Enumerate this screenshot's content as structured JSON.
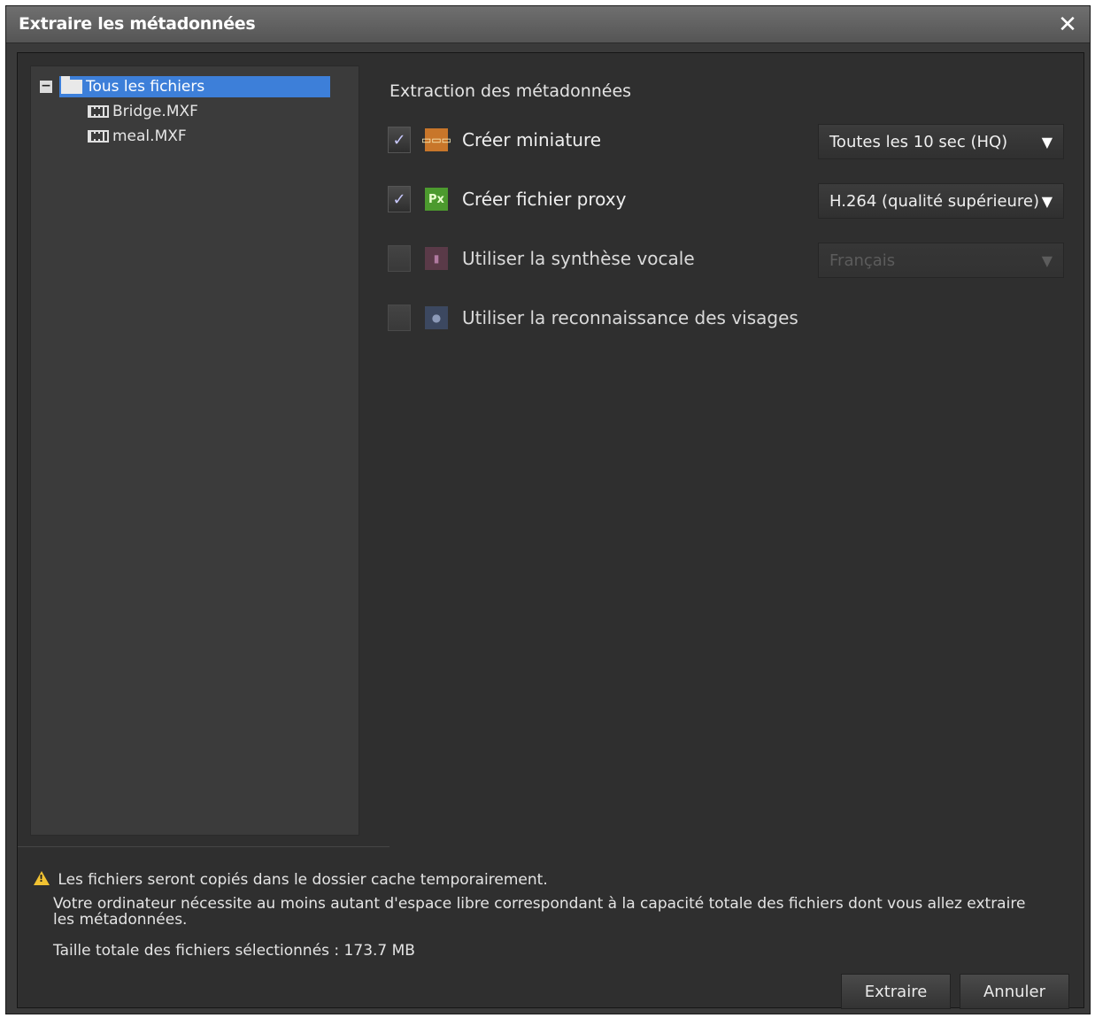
{
  "window": {
    "title": "Extraire les métadonnées",
    "close_glyph": "✕"
  },
  "tree": {
    "root": {
      "label": "Tous les fichiers",
      "toggle": "−",
      "icon": "folder-icon",
      "selected": true
    },
    "children": [
      {
        "label": "Bridge.MXF",
        "icon": "film-clip-icon"
      },
      {
        "label": "meal.MXF",
        "icon": "film-clip-icon"
      }
    ]
  },
  "options": {
    "section_title": "Extraction des métadonnées",
    "items": [
      {
        "label": "Créer miniature",
        "checked": true,
        "enabled": true,
        "icon": "thumbnail-icon",
        "icon_text": "▭▭▭",
        "dropdown": "Toutes les 10 sec (HQ)"
      },
      {
        "label": "Créer fichier proxy",
        "checked": true,
        "enabled": true,
        "icon": "proxy-icon",
        "icon_text": "Px",
        "dropdown": "H.264 (qualité supérieure)"
      },
      {
        "label": "Utiliser la synthèse vocale",
        "checked": false,
        "enabled": true,
        "icon": "speech-icon",
        "icon_text": "▮",
        "dropdown": "Français",
        "dropdown_disabled": true
      },
      {
        "label": "Utiliser la reconnaissance des visages",
        "checked": false,
        "enabled": true,
        "icon": "face-icon",
        "icon_text": "●"
      }
    ],
    "check_glyph": "✓",
    "dropdown_arrow": "▼"
  },
  "notices": {
    "warning": "Les fichiers seront copiés dans le dossier cache temporairement.",
    "space": "Votre ordinateur nécessite au moins autant d'espace libre correspondant à la capacité totale des fichiers dont vous allez extraire les métadonnées.",
    "total": "Taille totale des fichiers sélectionnés : 173.7 MB"
  },
  "buttons": {
    "extract": "Extraire",
    "cancel": "Annuler"
  },
  "colors": {
    "selection": "#3d7fd9",
    "warning": "#f1c232",
    "background": "#2f2f2f"
  }
}
